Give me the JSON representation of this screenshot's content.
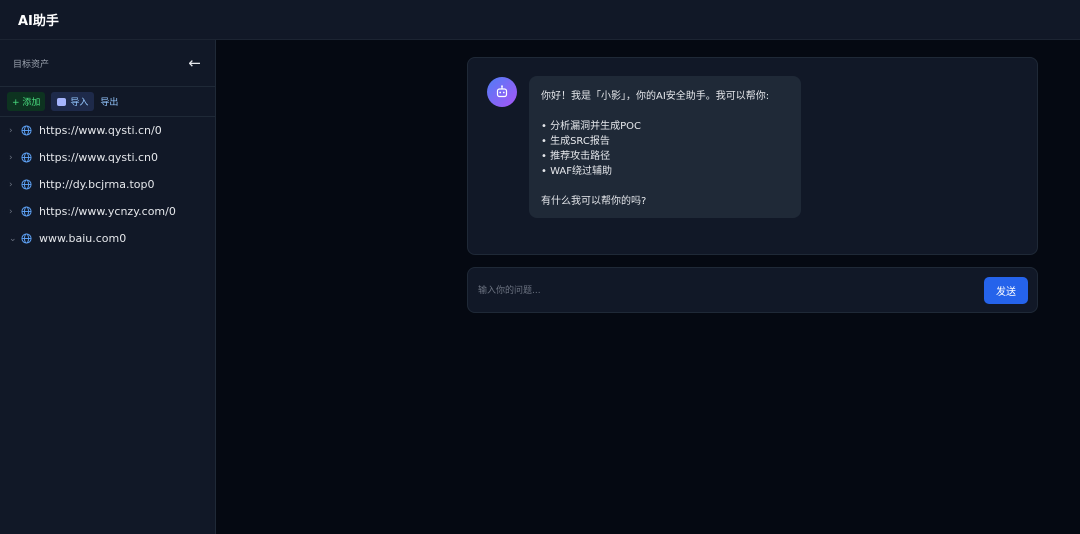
{
  "app": {
    "title": "AI助手"
  },
  "sidebar": {
    "title": "目标资产",
    "back_icon": "arrow-left-icon",
    "actions": {
      "add": "+ 添加",
      "import": "导入",
      "export": "导出"
    },
    "assets": [
      {
        "label": "https://www.qysti.cn/0",
        "expanded": false
      },
      {
        "label": "https://www.qysti.cn0",
        "expanded": false
      },
      {
        "label": "http://dy.bcjrma.top0",
        "expanded": false
      },
      {
        "label": "https://www.ycnzy.com/0",
        "expanded": false
      },
      {
        "label": "www.baiu.com0",
        "expanded": true
      }
    ]
  },
  "chat": {
    "messages": [
      {
        "sender": "bot",
        "avatar_icon": "robot-icon",
        "greeting": "你好！我是「小影」，你的AI安全助手。我可以帮你:",
        "bullets": [
          "• 分析漏洞并生成POC",
          "• 生成SRC报告",
          "• 推荐攻击路径",
          "• WAF绕过辅助"
        ],
        "closing": "有什么我可以帮你的吗?"
      }
    ],
    "input_placeholder": "输入你的问题...",
    "send_label": "发送"
  },
  "colors": {
    "accent": "#2563eb",
    "add_green": "#4ade80",
    "link_blue": "#93c5fd"
  }
}
